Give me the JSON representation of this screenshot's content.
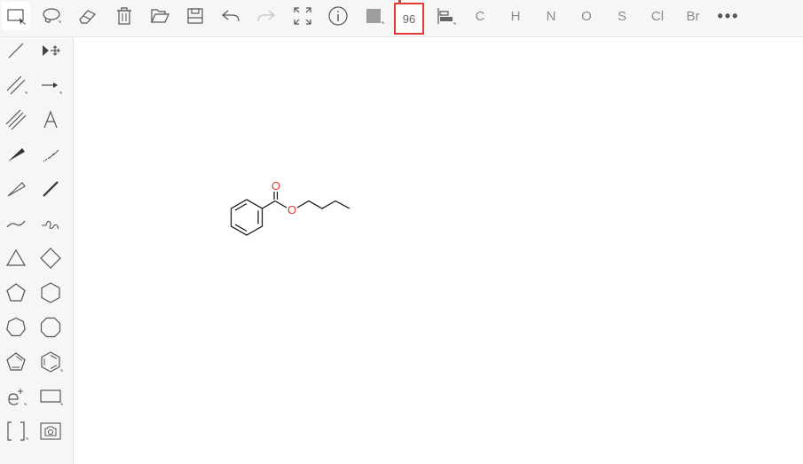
{
  "toolbar": {
    "zoom_value": "96",
    "atoms": [
      "C",
      "H",
      "N",
      "O",
      "S",
      "Cl",
      "Br"
    ],
    "more_label": "•••"
  },
  "molecule": {
    "label_O_carbonyl": "O",
    "label_O_ester": "O"
  },
  "colors": {
    "highlight": "#e53935",
    "oxygen": "#e53935"
  }
}
